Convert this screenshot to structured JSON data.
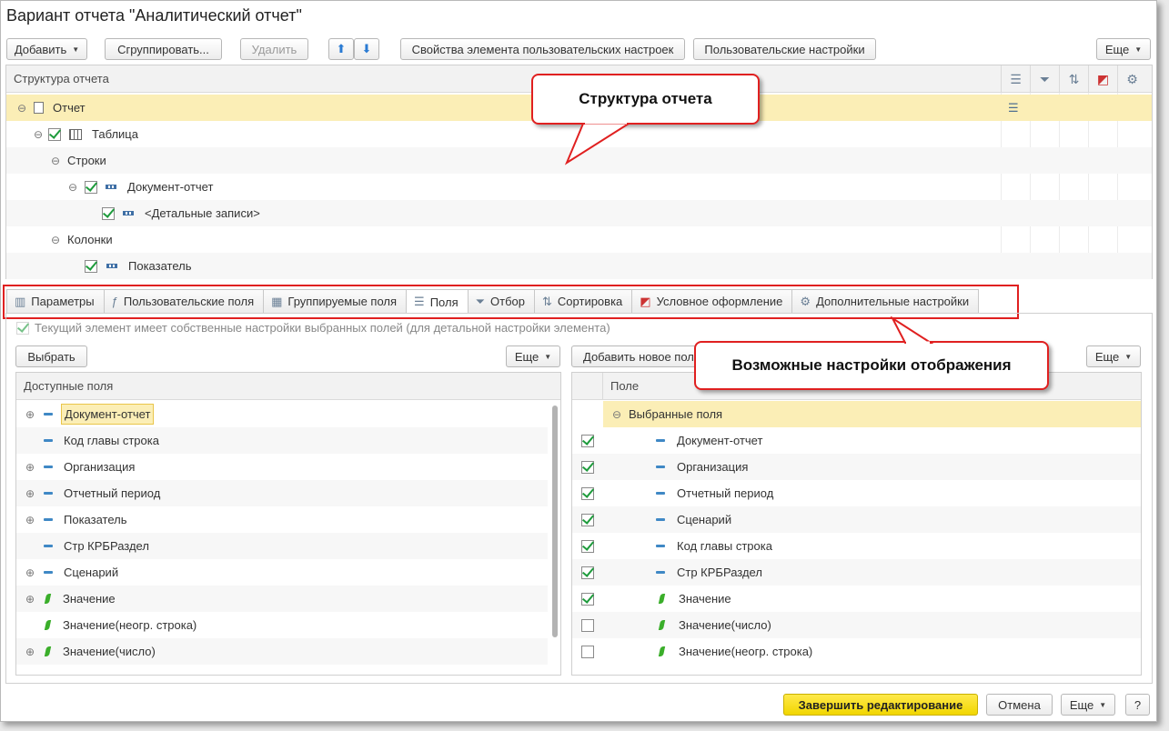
{
  "window": {
    "title": "Вариант отчета \"Аналитический отчет\""
  },
  "toolbar": {
    "add": "Добавить",
    "group": "Сгруппировать...",
    "delete": "Удалить",
    "up": "🡅",
    "down": "🡇",
    "element_props": "Свойства элемента пользовательских настроек",
    "user_settings": "Пользовательские настройки",
    "more": "Еще"
  },
  "structure": {
    "header": "Структура отчета",
    "header_icons": [
      "fields-icon",
      "filter-icon",
      "sort-icon",
      "conditional-format-icon",
      "extra-settings-icon"
    ],
    "rows": [
      {
        "label": "Отчет",
        "expander": "⊖",
        "checked": null,
        "icon": "document-icon"
      },
      {
        "label": "Таблица",
        "expander": "⊖",
        "checked": true,
        "icon": "table-icon"
      },
      {
        "label": "Строки",
        "expander": "⊖",
        "checked": null,
        "icon": ""
      },
      {
        "label": "Документ-отчет",
        "expander": "⊖",
        "checked": true,
        "icon": "grouping-icon"
      },
      {
        "label": "<Детальные записи>",
        "expander": "",
        "checked": true,
        "icon": "grouping-icon"
      },
      {
        "label": "Колонки",
        "expander": "⊖",
        "checked": null,
        "icon": ""
      },
      {
        "label": "Показатель",
        "expander": "",
        "checked": true,
        "icon": "grouping-icon"
      }
    ]
  },
  "callouts": {
    "structure": "Структура отчета",
    "display": "Возможные настройки отображения"
  },
  "tabs": [
    {
      "label": "Параметры",
      "icon": "parameters-icon",
      "active": false
    },
    {
      "label": "Пользовательские поля",
      "icon": "custom-fields-icon",
      "active": false
    },
    {
      "label": "Группируемые поля",
      "icon": "group-fields-icon",
      "active": false
    },
    {
      "label": "Поля",
      "icon": "fields-icon",
      "active": true
    },
    {
      "label": "Отбор",
      "icon": "filter-icon",
      "active": false
    },
    {
      "label": "Сортировка",
      "icon": "sort-icon",
      "active": false
    },
    {
      "label": "Условное оформление",
      "icon": "conditional-format-icon",
      "active": false
    },
    {
      "label": "Дополнительные настройки",
      "icon": "extra-settings-icon",
      "active": false
    }
  ],
  "own_settings": {
    "label": "Текущий элемент имеет собственные настройки выбранных полей (для детальной настройки элемента)",
    "checked": true
  },
  "available": {
    "select_btn": "Выбрать",
    "more": "Еще",
    "header": "Доступные поля",
    "items": [
      {
        "label": "Документ-отчет",
        "expand": true,
        "kind": "dash",
        "selected": true
      },
      {
        "label": "Код главы строка",
        "expand": false,
        "kind": "dash",
        "selected": false
      },
      {
        "label": "Организация",
        "expand": true,
        "kind": "dash",
        "selected": false
      },
      {
        "label": "Отчетный период",
        "expand": true,
        "kind": "dash",
        "selected": false
      },
      {
        "label": "Показатель",
        "expand": true,
        "kind": "dash",
        "selected": false
      },
      {
        "label": "Стр КРБРаздел",
        "expand": false,
        "kind": "dash",
        "selected": false
      },
      {
        "label": "Сценарий",
        "expand": true,
        "kind": "dash",
        "selected": false
      },
      {
        "label": "Значение",
        "expand": true,
        "kind": "leaf",
        "selected": false
      },
      {
        "label": "Значение(неогр. строка)",
        "expand": false,
        "kind": "leaf",
        "selected": false
      },
      {
        "label": "Значение(число)",
        "expand": true,
        "kind": "leaf",
        "selected": false
      }
    ]
  },
  "selected": {
    "add_btn": "Добавить новое поле",
    "more": "Еще",
    "header": "Поле",
    "group_label": "Выбранные поля",
    "items": [
      {
        "label": "Документ-отчет",
        "checked": true,
        "kind": "dash"
      },
      {
        "label": "Организация",
        "checked": true,
        "kind": "dash"
      },
      {
        "label": "Отчетный период",
        "checked": true,
        "kind": "dash"
      },
      {
        "label": "Сценарий",
        "checked": true,
        "kind": "dash"
      },
      {
        "label": "Код главы строка",
        "checked": true,
        "kind": "dash"
      },
      {
        "label": "Стр КРБРаздел",
        "checked": true,
        "kind": "dash"
      },
      {
        "label": "Значение",
        "checked": true,
        "kind": "leaf"
      },
      {
        "label": "Значение(число)",
        "checked": false,
        "kind": "leaf"
      },
      {
        "label": "Значение(неогр. строка)",
        "checked": false,
        "kind": "leaf"
      }
    ]
  },
  "footer": {
    "finish": "Завершить редактирование",
    "cancel": "Отмена",
    "more": "Еще",
    "help": "?"
  },
  "colors": {
    "highlight": "#fbeeb6",
    "callout_border": "#e02020",
    "check": "#1e9b3c",
    "accent": "#f1d600"
  }
}
